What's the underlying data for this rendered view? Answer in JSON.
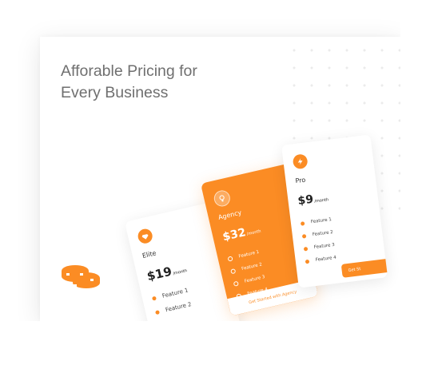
{
  "hero": {
    "headline": "Afforable Pricing for\nEvery Business"
  },
  "icons": {
    "coins": "coins-icon",
    "elite_badge": "diamond-icon",
    "agency_badge": "lightbulb-icon",
    "pro_badge": "lightning-icon"
  },
  "colors": {
    "accent": "#fb8c24",
    "text": "#6f6f6f"
  },
  "plans": [
    {
      "name": "Elite",
      "price": "$19",
      "period": "/month",
      "features": [
        "Feature 1",
        "Feature 2"
      ]
    },
    {
      "name": "Agency",
      "price": "$32",
      "period": "/month",
      "features": [
        "Feature 1",
        "Feature 2",
        "Feature 3",
        "Feature 4"
      ],
      "cta": "Get Started with Agency"
    },
    {
      "name": "Pro",
      "price": "$9",
      "period": "/month",
      "features": [
        "Feature 1",
        "Feature 2",
        "Feature 3",
        "Feature 4"
      ],
      "cta": "Get St"
    }
  ]
}
